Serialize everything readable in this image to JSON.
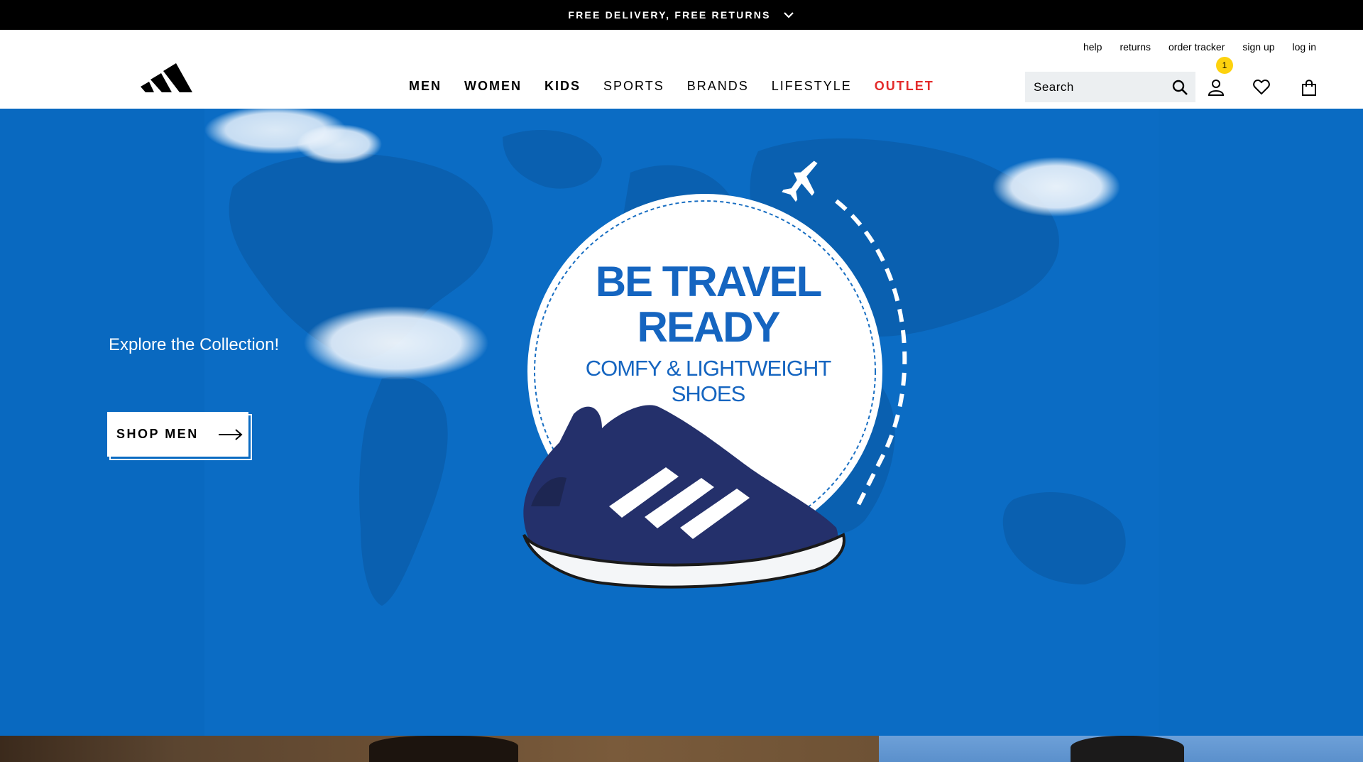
{
  "promo_bar": {
    "text": "FREE DELIVERY, FREE RETURNS"
  },
  "utility_nav": [
    "help",
    "returns",
    "order tracker",
    "sign up",
    "log in"
  ],
  "main_nav": [
    {
      "label": "MEN"
    },
    {
      "label": "WOMEN"
    },
    {
      "label": "KIDS"
    },
    {
      "label": "SPORTS"
    },
    {
      "label": "BRANDS"
    },
    {
      "label": "LIFESTYLE"
    },
    {
      "label": "OUTLET"
    }
  ],
  "search": {
    "placeholder": "Search"
  },
  "account": {
    "badge_count": "1"
  },
  "icons": [
    "chevron-down-icon",
    "brand-logo",
    "search-icon",
    "user-icon",
    "heart-icon",
    "bag-icon",
    "arrow-right-icon",
    "airplane-icon"
  ],
  "colors": {
    "hero_bg": "#0a6bc2",
    "outlet": "#e32b2b",
    "badge": "#fdd20e",
    "headline": "#1565c0",
    "shoe": "#24306b"
  },
  "hero": {
    "tagline": "Explore the Collection!",
    "cta": "SHOP MEN",
    "headline_line1": "BE TRAVEL",
    "headline_line2": "READY",
    "sub_line1": "COMFY & LIGHTWEIGHT",
    "sub_line2": "SHOES"
  }
}
